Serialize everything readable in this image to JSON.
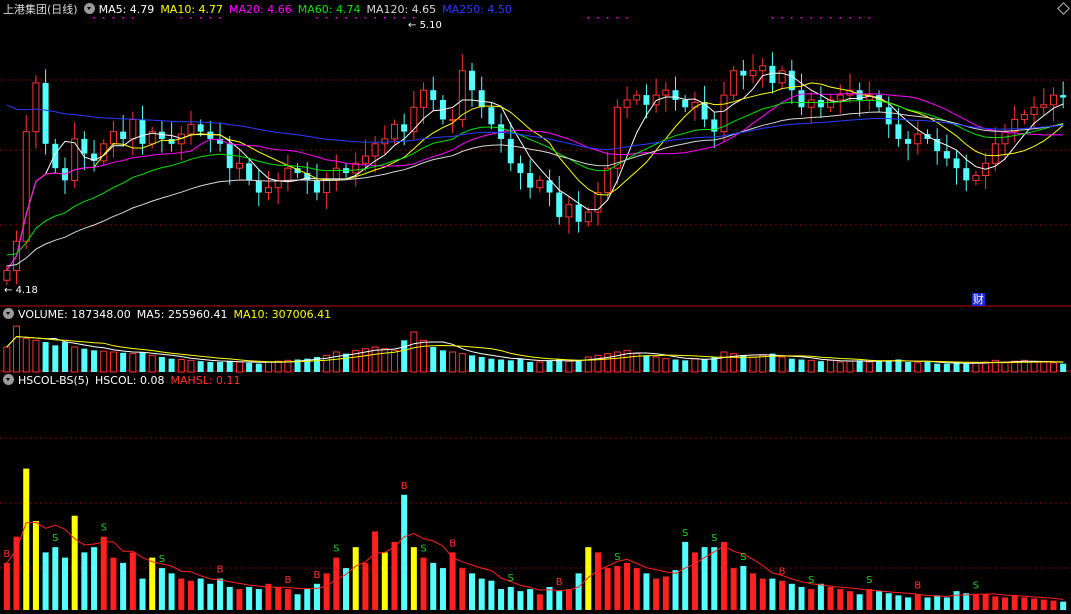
{
  "header": {
    "title": "上港集团(日线)",
    "ma": [
      {
        "label": "MA5: 4.79",
        "color": "#ffffff"
      },
      {
        "label": "MA10: 4.77",
        "color": "#ffff00"
      },
      {
        "label": "MA20: 4.66",
        "color": "#ff00ff"
      },
      {
        "label": "MA60: 4.74",
        "color": "#00e400"
      },
      {
        "label": "MA120: 4.65",
        "color": "#d9d9d9"
      },
      {
        "label": "MA250: 4.50",
        "color": "#2a3cff"
      }
    ]
  },
  "price_panel": {
    "high_label": "5.10",
    "low_label": "4.18",
    "badge": "财"
  },
  "volume_panel": {
    "title": "VOLUME: 187348.00",
    "ma5": "MA5: 255960.41",
    "ma10": "MA10: 307006.41"
  },
  "indicator_panel": {
    "title": "HSCOL-BS(5)",
    "hscol": "HSCOL: 0.08",
    "mahsl": "MAHSL: 0.11",
    "buy_mark": "B",
    "sell_mark": "S"
  },
  "colors": {
    "up": "#ff3232",
    "down": "#54ffff",
    "hscol_up": "#ff2020",
    "hscol_high": "#ffff00",
    "grid": "#8b0000",
    "sell": "#1fd11f",
    "buy": "#ff3232"
  },
  "chart_data": {
    "type": "candlestick",
    "closes": [
      4.18,
      4.3,
      4.75,
      4.95,
      4.7,
      4.6,
      4.55,
      4.72,
      4.66,
      4.63,
      4.7,
      4.75,
      4.72,
      4.8,
      4.7,
      4.75,
      4.72,
      4.7,
      4.74,
      4.78,
      4.75,
      4.72,
      4.7,
      4.6,
      4.62,
      4.55,
      4.5,
      4.52,
      4.55,
      4.6,
      4.58,
      4.55,
      4.5,
      4.55,
      4.6,
      4.58,
      4.62,
      4.65,
      4.7,
      4.72,
      4.78,
      4.75,
      4.85,
      4.92,
      4.88,
      4.8,
      4.8,
      5.0,
      4.92,
      4.85,
      4.78,
      4.72,
      4.62,
      4.58,
      4.52,
      4.55,
      4.5,
      4.4,
      4.45,
      4.38,
      4.42,
      4.5,
      4.6,
      4.85,
      4.88,
      4.9,
      4.86,
      4.9,
      4.92,
      4.88,
      4.85,
      4.87,
      4.8,
      4.75,
      4.9,
      5.0,
      4.98,
      5.0,
      5.02,
      4.95,
      5.0,
      4.92,
      4.85,
      4.88,
      4.85,
      4.88,
      4.9,
      4.92,
      4.88,
      4.9,
      4.85,
      4.78,
      4.72,
      4.7,
      4.74,
      4.72,
      4.67,
      4.64,
      4.6,
      4.55,
      4.57,
      4.62,
      4.7,
      4.75,
      4.8,
      4.82,
      4.85,
      4.86,
      4.9,
      4.89
    ],
    "volumes": [
      30,
      55,
      40,
      38,
      36,
      32,
      36,
      30,
      28,
      26,
      25,
      24,
      23,
      22,
      24,
      20,
      18,
      16,
      15,
      14,
      13,
      12,
      12,
      13,
      12,
      11,
      10,
      12,
      13,
      14,
      15,
      16,
      18,
      20,
      24,
      22,
      26,
      28,
      30,
      28,
      26,
      38,
      48,
      38,
      30,
      26,
      24,
      22,
      20,
      18,
      16,
      15,
      14,
      16,
      12,
      12,
      14,
      15,
      13,
      14,
      18,
      20,
      22,
      24,
      26,
      22,
      20,
      18,
      16,
      15,
      14,
      16,
      15,
      18,
      24,
      22,
      20,
      18,
      20,
      22,
      18,
      16,
      15,
      14,
      13,
      14,
      12,
      13,
      14,
      12,
      13,
      14,
      15,
      12,
      11,
      12,
      10,
      10,
      11,
      10,
      11,
      12,
      14,
      12,
      13,
      14,
      12,
      12,
      11,
      10
    ],
    "volume_ylim": [
      0,
      60
    ],
    "hscol": [
      0.45,
      0.7,
      1.35,
      0.85,
      0.55,
      0.6,
      0.5,
      0.9,
      0.55,
      0.6,
      0.7,
      0.5,
      0.45,
      0.55,
      0.3,
      0.5,
      0.4,
      0.35,
      0.3,
      0.28,
      0.3,
      0.25,
      0.3,
      0.22,
      0.2,
      0.22,
      0.2,
      0.25,
      0.22,
      0.2,
      0.15,
      0.2,
      0.25,
      0.35,
      0.5,
      0.4,
      0.6,
      0.45,
      0.75,
      0.55,
      0.65,
      1.1,
      0.6,
      0.5,
      0.45,
      0.4,
      0.55,
      0.4,
      0.35,
      0.3,
      0.28,
      0.2,
      0.22,
      0.18,
      0.2,
      0.15,
      0.22,
      0.18,
      0.2,
      0.35,
      0.6,
      0.55,
      0.4,
      0.42,
      0.45,
      0.4,
      0.35,
      0.3,
      0.32,
      0.38,
      0.65,
      0.55,
      0.6,
      0.6,
      0.65,
      0.4,
      0.42,
      0.35,
      0.3,
      0.3,
      0.28,
      0.25,
      0.22,
      0.2,
      0.25,
      0.22,
      0.2,
      0.18,
      0.15,
      0.2,
      0.18,
      0.16,
      0.14,
      0.12,
      0.15,
      0.12,
      0.14,
      0.12,
      0.18,
      0.16,
      0.15,
      0.15,
      0.13,
      0.12,
      0.14,
      0.12,
      0.11,
      0.1,
      0.09,
      0.08
    ],
    "hscol_ylim": [
      0,
      2.1
    ],
    "ylim": [
      4.1,
      5.2
    ]
  }
}
